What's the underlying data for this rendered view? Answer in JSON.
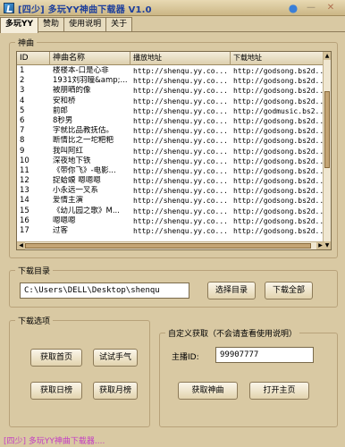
{
  "window": {
    "title": "[四少] 多玩YY神曲下载器 V1.0",
    "icon": "app-logo-icon",
    "pin_icon": "pin-icon",
    "min_glyph": "—",
    "close_glyph": "✕"
  },
  "tabs": [
    "多玩YY",
    "赞助",
    "使用说明",
    "关于"
  ],
  "songs_group": {
    "label": "神曲",
    "columns": [
      "ID",
      "神曲名称",
      "播放地址",
      "下载地址"
    ],
    "rows": [
      {
        "id": "1",
        "name": "楼楼本-口是心非",
        "play": "http://shenqu.yy.co...",
        "dl": "http://godsong.bs2d..."
      },
      {
        "id": "2",
        "name": "1931刘羽瞳&amp;...",
        "play": "http://shenqu.yy.co...",
        "dl": "http://godsong.bs2d..."
      },
      {
        "id": "3",
        "name": "被朋晒的像",
        "play": "http://shenqu.yy.co...",
        "dl": "http://godsong.bs2d..."
      },
      {
        "id": "4",
        "name": "安和桥",
        "play": "http://shenqu.yy.co...",
        "dl": "http://godsong.bs2d..."
      },
      {
        "id": "5",
        "name": "前郎",
        "play": "http://shenqu.yy.co...",
        "dl": "http://godmusic.bs2..."
      },
      {
        "id": "6",
        "name": "8秒男",
        "play": "http://shenqu.yy.co...",
        "dl": "http://godsong.bs2d..."
      },
      {
        "id": "7",
        "name": "字就比品教抚估。",
        "play": "http://shenqu.yy.co...",
        "dl": "http://godsong.bs2d..."
      },
      {
        "id": "8",
        "name": "断情比之一坨粑粑",
        "play": "http://shenqu.yy.co...",
        "dl": "http://godsong.bs2d..."
      },
      {
        "id": "9",
        "name": "我叫阿红",
        "play": "http://shenqu.yy.co...",
        "dl": "http://godsong.bs2d..."
      },
      {
        "id": "10",
        "name": "深夜地下铁",
        "play": "http://shenqu.yy.co...",
        "dl": "http://godsong.bs2d..."
      },
      {
        "id": "11",
        "name": "《带你飞》-电影...",
        "play": "http://shenqu.yy.co...",
        "dl": "http://godsong.bs2d..."
      },
      {
        "id": "12",
        "name": "捉蛤蟆 嗯嗯嗯",
        "play": "http://shenqu.yy.co...",
        "dl": "http://godsong.bs2d..."
      },
      {
        "id": "13",
        "name": "小永远一叉系",
        "play": "http://shenqu.yy.co...",
        "dl": "http://godsong.bs2d..."
      },
      {
        "id": "14",
        "name": "爱情主演",
        "play": "http://shenqu.yy.co...",
        "dl": "http://godsong.bs2d..."
      },
      {
        "id": "15",
        "name": "《幼儿园之歌》M...",
        "play": "http://shenqu.yy.co...",
        "dl": "http://godsong.bs2d..."
      },
      {
        "id": "16",
        "name": "嗯嗯嗯",
        "play": "http://shenqu.yy.co...",
        "dl": "http://godsong.bs2d..."
      },
      {
        "id": "17",
        "name": "过客",
        "play": "http://shenqu.yy.co...",
        "dl": "http://godsong.bs2d..."
      }
    ]
  },
  "download_dir": {
    "label": "下载目录",
    "path": "C:\\Users\\DELL\\Desktop\\shenqu",
    "select_button": "选择目录",
    "download_all_button": "下载全部"
  },
  "options": {
    "label": "下载选项",
    "btn_home": "获取首页",
    "btn_luck": "试试手气",
    "btn_daily": "获取日榜",
    "btn_monthly": "获取月榜"
  },
  "custom": {
    "label": "自定义获取（不会请查看使用说明）",
    "host_label": "主播ID:",
    "host_value": "99907777",
    "get_button": "获取神曲",
    "open_button": "打开主页"
  },
  "status": "[四少] 多玩YY神曲下载器...."
}
